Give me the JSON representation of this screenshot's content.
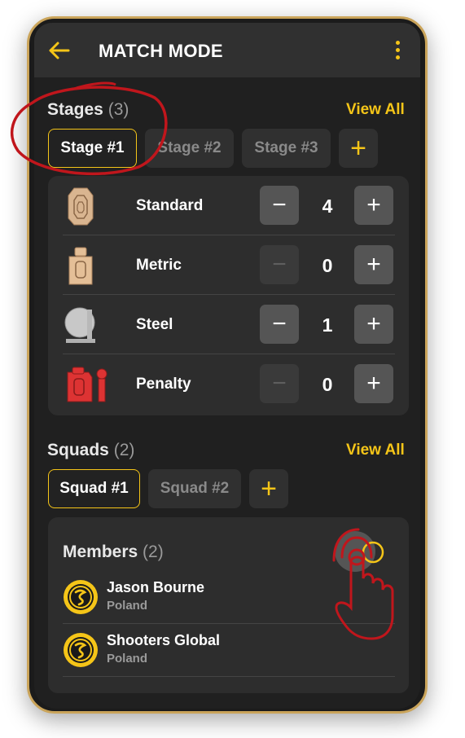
{
  "header": {
    "title": "MATCH MODE",
    "back_icon": "arrow-left-icon",
    "menu_icon": "vertical-dots-icon"
  },
  "accent_color": "#f5c518",
  "stages": {
    "title": "Stages",
    "count": "(3)",
    "view_all": "View All",
    "tabs": [
      {
        "label": "Stage #1",
        "active": true
      },
      {
        "label": "Stage #2",
        "active": false
      },
      {
        "label": "Stage #3",
        "active": false
      }
    ],
    "add_label": "+",
    "targets": [
      {
        "label": "Standard",
        "value": "4",
        "minus": "−",
        "plus": "+",
        "icon": "standard-target-icon"
      },
      {
        "label": "Metric",
        "value": "0",
        "minus": "−",
        "plus": "+",
        "icon": "metric-target-icon"
      },
      {
        "label": "Steel",
        "value": "1",
        "minus": "−",
        "plus": "+",
        "icon": "steel-target-icon"
      },
      {
        "label": "Penalty",
        "value": "0",
        "minus": "−",
        "plus": "+",
        "icon": "penalty-target-icon"
      }
    ]
  },
  "squads": {
    "title": "Squads",
    "count": "(2)",
    "view_all": "View All",
    "tabs": [
      {
        "label": "Squad #1",
        "active": true
      },
      {
        "label": "Squad #2",
        "active": false
      }
    ],
    "add_label": "+"
  },
  "members": {
    "title": "Members",
    "count": "(2)",
    "list": [
      {
        "name": "Jason Bourne",
        "country": "Poland",
        "avatar": "shooters-global-logo-icon"
      },
      {
        "name": "Shooters Global",
        "country": "Poland",
        "avatar": "shooters-global-logo-icon"
      }
    ]
  }
}
